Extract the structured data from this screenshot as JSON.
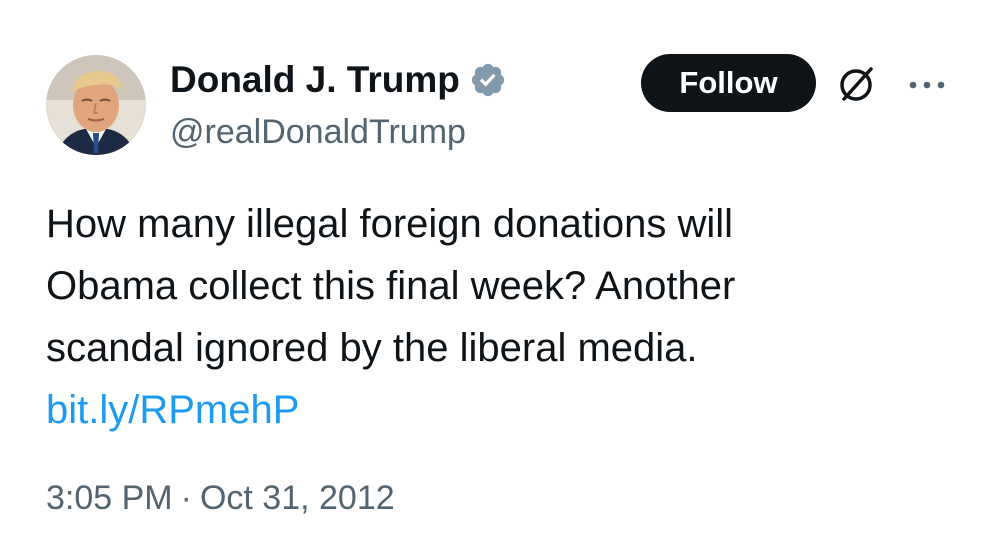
{
  "author": {
    "display_name": "Donald J. Trump",
    "handle": "@realDonaldTrump",
    "verified_icon": "verified-badge-icon",
    "avatar": "profile-photo"
  },
  "actions": {
    "follow_label": "Follow",
    "grok_icon": "grok-icon",
    "more_icon": "more-options-icon"
  },
  "tweet": {
    "lines": [
      "How many illegal foreign donations will",
      "Obama collect this final week? Another",
      "scandal ignored by the liberal media."
    ],
    "link": "bit.ly/RPmehP"
  },
  "meta": {
    "time": "3:05 PM",
    "separator": "·",
    "date": "Oct 31, 2012"
  },
  "colors": {
    "text": "#0f1419",
    "secondary": "#536471",
    "link": "#1d9bf0",
    "verified": "#829aab",
    "button_bg": "#0f1419",
    "button_text": "#ffffff"
  }
}
